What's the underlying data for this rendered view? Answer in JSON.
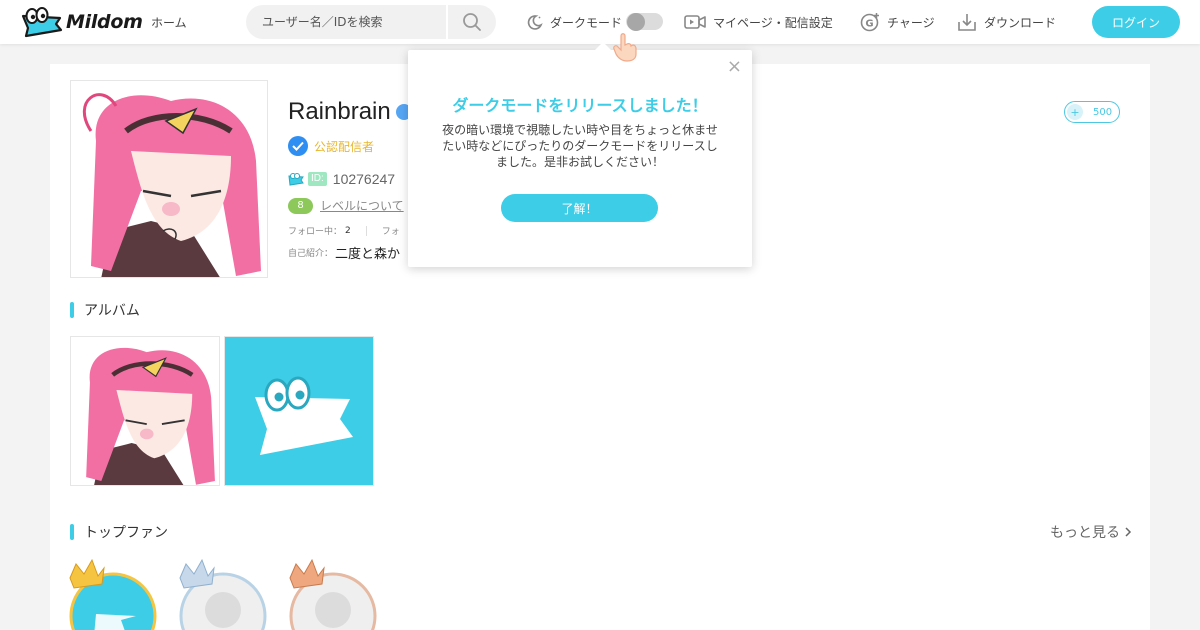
{
  "header": {
    "logo_text": "Mildom",
    "home_label": "ホーム",
    "search_placeholder": "ユーザー名／IDを検索",
    "dark_mode_label": "ダークモード",
    "mypage_label": "マイページ・配信設定",
    "charge_label": "チャージ",
    "download_label": "ダウンロード",
    "login_label": "ログイン"
  },
  "profile": {
    "name": "Rainbrain",
    "verified_label": "公認配信者",
    "id_chip": "ID:",
    "id_value": "10276247",
    "level": "8",
    "level_link": "レベルについて",
    "following_label": "フォロー中：",
    "following_count": "2",
    "followers_label": "フォ",
    "bio_label": "自己紹介：",
    "bio_text": "二度と森か",
    "fans_plus": "+",
    "fans_count": "500"
  },
  "album": {
    "title": "アルバム"
  },
  "top_fans": {
    "title": "トップファン",
    "more_label": "もっと見る"
  },
  "popup": {
    "title": "ダークモードをリリースしました！",
    "body": "夜の暗い環境で視聴したい時や目をちょっと休ませたい時などにぴったりのダークモードをリリースしました。是非お試しください！",
    "button_label": "了解！",
    "close_symbol": "×"
  },
  "colors": {
    "accent": "#3dcde6",
    "verified_gold": "#e8b62c",
    "verified_blue": "#2f8ef2",
    "level_green": "#8cc95a",
    "hair_pink": "#f26fa3"
  }
}
